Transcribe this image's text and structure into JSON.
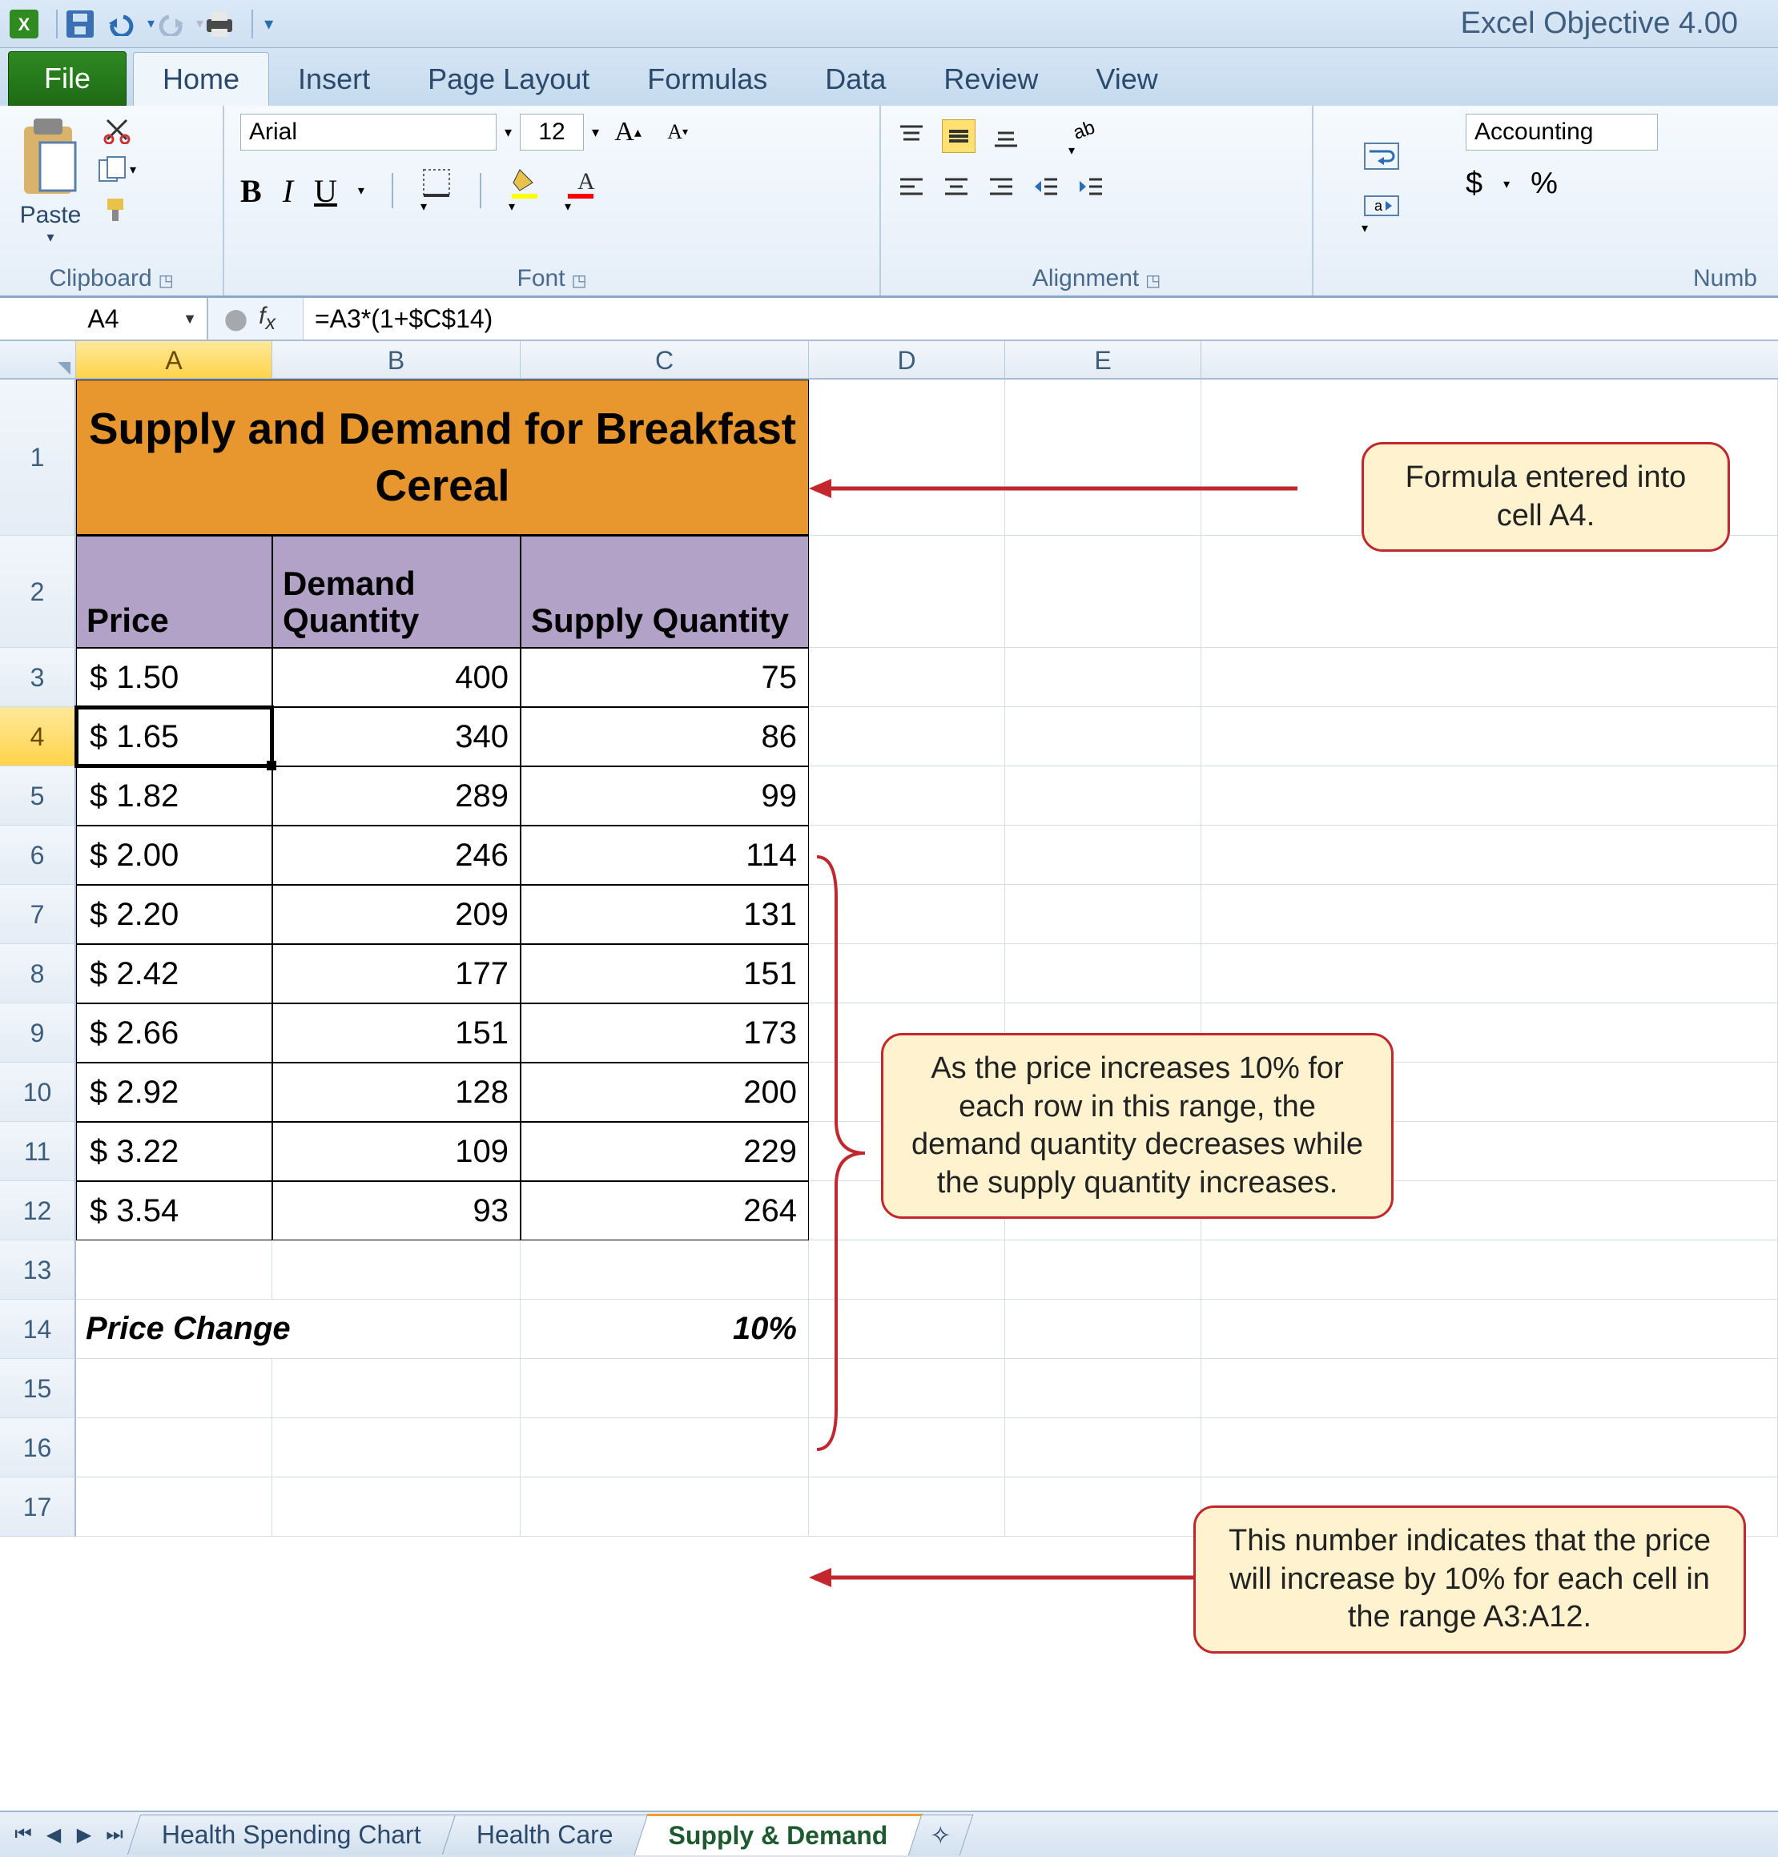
{
  "window_title": "Excel Objective 4.00",
  "tabs": {
    "file": "File",
    "items": [
      "Home",
      "Insert",
      "Page Layout",
      "Formulas",
      "Data",
      "Review",
      "View"
    ],
    "active": "Home"
  },
  "ribbon": {
    "clipboard": {
      "paste": "Paste",
      "label": "Clipboard"
    },
    "font": {
      "name": "Arial",
      "size": "12",
      "label": "Font"
    },
    "alignment": {
      "label": "Alignment"
    },
    "number": {
      "format": "Accounting",
      "label": "Numb"
    }
  },
  "name_box": "A4",
  "formula": "=A3*(1+$C$14)",
  "columns": [
    "A",
    "B",
    "C",
    "D",
    "E"
  ],
  "chart_data": {
    "type": "table",
    "title": "Supply and Demand for Breakfast Cereal",
    "headers": {
      "A": "Price",
      "B": "Demand Quantity",
      "C": "Supply Quantity"
    },
    "rows": [
      {
        "price": "$   1.50",
        "demand": "400",
        "supply": "75"
      },
      {
        "price": "$   1.65",
        "demand": "340",
        "supply": "86"
      },
      {
        "price": "$   1.82",
        "demand": "289",
        "supply": "99"
      },
      {
        "price": "$   2.00",
        "demand": "246",
        "supply": "114"
      },
      {
        "price": "$   2.20",
        "demand": "209",
        "supply": "131"
      },
      {
        "price": "$   2.42",
        "demand": "177",
        "supply": "151"
      },
      {
        "price": "$   2.66",
        "demand": "151",
        "supply": "173"
      },
      {
        "price": "$   2.92",
        "demand": "128",
        "supply": "200"
      },
      {
        "price": "$   3.22",
        "demand": "109",
        "supply": "229"
      },
      {
        "price": "$   3.54",
        "demand": "93",
        "supply": "264"
      }
    ],
    "price_change_label": "Price Change",
    "price_change_value": "10%"
  },
  "row_numbers": [
    "1",
    "2",
    "3",
    "4",
    "5",
    "6",
    "7",
    "8",
    "9",
    "10",
    "11",
    "12",
    "13",
    "14",
    "15",
    "16",
    "17"
  ],
  "sheet_tabs": [
    "Health Spending Chart",
    "Health Care",
    "Supply & Demand"
  ],
  "active_sheet": "Supply & Demand",
  "callouts": {
    "c1": "Formula entered into cell A4.",
    "c2": "As the price increases 10% for each row in this range, the demand quantity decreases while the supply quantity increases.",
    "c3": "This number indicates that the price will increase by 10% for each cell in the range A3:A12."
  },
  "icons": {
    "bold": "B",
    "italic": "I",
    "underline": "U",
    "currency": "$",
    "percent": "%"
  }
}
